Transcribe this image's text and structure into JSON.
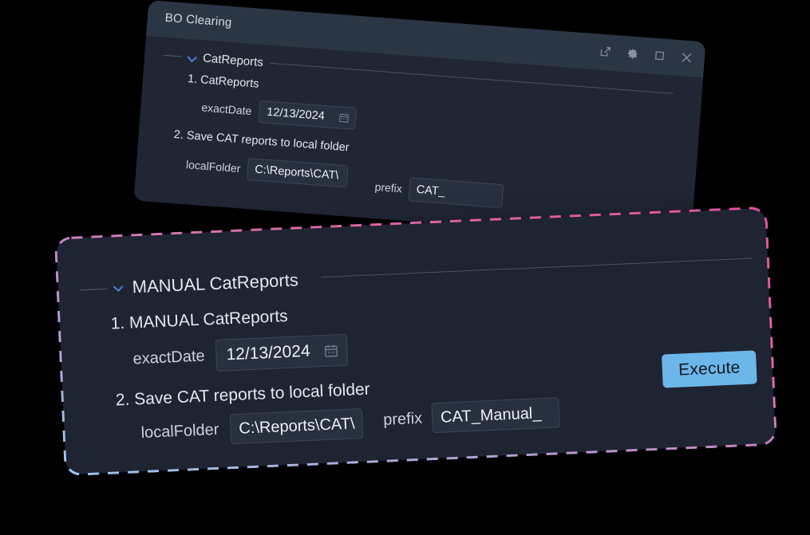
{
  "background_color": "#000000",
  "accent": {
    "button_blue": "#6cb6ea",
    "chevron_blue": "#4a7fd0",
    "dashed_border_top": "#e0549c",
    "dashed_border_mid": "#c09ad0",
    "dashed_border_bottom": "#9ec8ea",
    "panel_bg": "#202634",
    "panel_bg_front": "#1e2431",
    "titlebar_bg": "#2b3645",
    "input_bg": "#27303f",
    "input_border": "#3b465a",
    "text": "#e3e7ee"
  },
  "back_window": {
    "title": "BO Clearing",
    "window_buttons": [
      {
        "name": "popout-icon",
        "label": "Open in new window"
      },
      {
        "name": "gear-icon",
        "label": "Settings"
      },
      {
        "name": "maximize-icon",
        "label": "Maximize"
      },
      {
        "name": "close-icon",
        "label": "Close"
      }
    ],
    "group": {
      "title": "CatReports",
      "expanded": true
    },
    "steps": [
      {
        "number": "1.",
        "label": "CatReports",
        "fields": [
          {
            "label": "exactDate",
            "type": "date",
            "value": "12/13/2024",
            "icon": "calendar-icon"
          }
        ]
      },
      {
        "number": "2.",
        "label": "Save CAT reports to local folder",
        "fields": [
          {
            "label": "localFolder",
            "type": "text",
            "value": "C:\\Reports\\CAT\\"
          },
          {
            "label": "prefix",
            "type": "text",
            "value": "CAT_"
          }
        ]
      }
    ]
  },
  "front_window": {
    "group": {
      "title": "MANUAL CatReports",
      "expanded": true
    },
    "steps": [
      {
        "number": "1.",
        "label": "MANUAL CatReports",
        "fields": [
          {
            "label": "exactDate",
            "type": "date",
            "value": "12/13/2024",
            "icon": "calendar-icon"
          }
        ]
      },
      {
        "number": "2.",
        "label": "Save CAT reports to local folder",
        "fields": [
          {
            "label": "localFolder",
            "type": "text",
            "value": "C:\\Reports\\CAT\\"
          },
          {
            "label": "prefix",
            "type": "text",
            "value": "CAT_Manual_"
          }
        ]
      }
    ],
    "execute_button": {
      "label": "Execute"
    }
  }
}
